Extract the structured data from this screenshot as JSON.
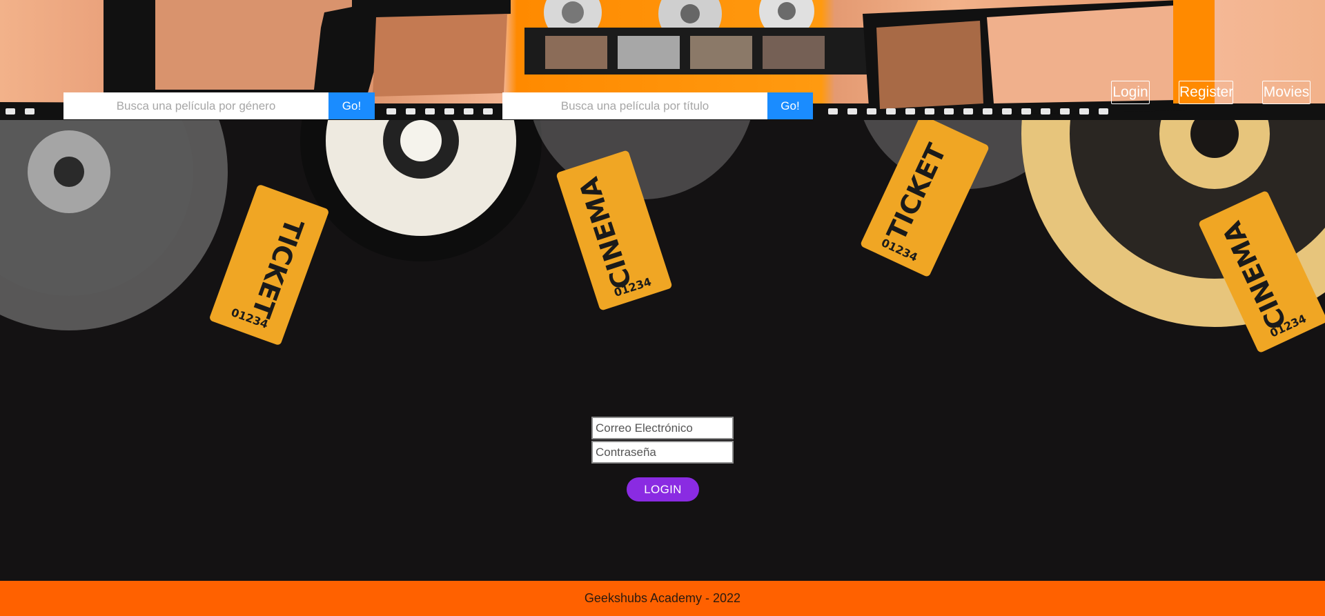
{
  "header": {
    "genre_search": {
      "placeholder": "Busca una película por género",
      "button_label": "Go!"
    },
    "title_search": {
      "placeholder": "Busca una película por título",
      "button_label": "Go!"
    },
    "nav": {
      "login": "Login",
      "register": "Register",
      "movies": "Movies"
    }
  },
  "decor": {
    "ticket_number": "01234",
    "ticket_words": [
      "TICKET",
      "CINEMA"
    ]
  },
  "login_form": {
    "email_placeholder": "Correo Electrónico",
    "password_placeholder": "Contraseña",
    "submit_label": "LOGIN"
  },
  "footer": {
    "text": "Geekshubs Academy - 2022"
  },
  "colors": {
    "header_orange": "#ff8a00",
    "go_button": "#1a8cff",
    "login_button": "#8a2be2",
    "footer": "#ff6100",
    "background": "#141213"
  }
}
